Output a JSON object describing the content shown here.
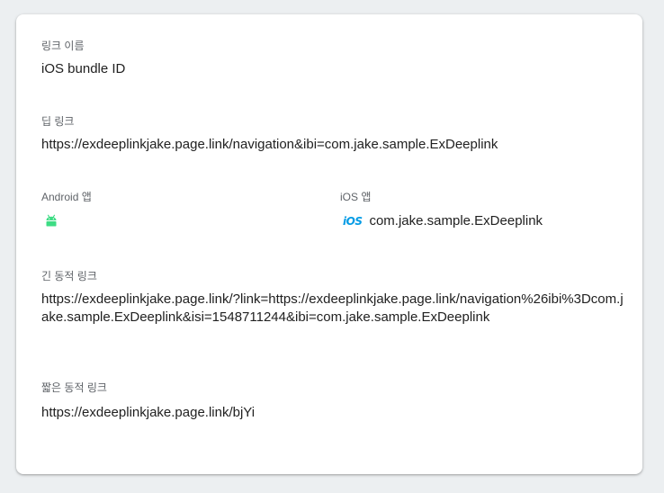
{
  "link_name": {
    "label": "링크 이름",
    "value": "iOS bundle ID"
  },
  "deep_link": {
    "label": "딥 링크",
    "value": "https://exdeeplinkjake.page.link/navigation&ibi=com.jake.sample.ExDeeplink"
  },
  "android_app": {
    "label": "Android 앱",
    "icon": "android-icon",
    "icon_color": "#3ddc84",
    "value": ""
  },
  "ios_app": {
    "label": "iOS 앱",
    "icon": "ios-icon",
    "icon_text": "iOS",
    "icon_color": "#039be5",
    "value": "com.jake.sample.ExDeeplink"
  },
  "long_dynamic_link": {
    "label": "긴 동적 링크",
    "value": "https://exdeeplinkjake.page.link/?link=https://exdeeplinkjake.page.link/navigation%26ibi%3Dcom.jake.sample.ExDeeplink&isi=1548711244&ibi=com.jake.sample.ExDeeplink"
  },
  "short_dynamic_link": {
    "label": "짧은 동적 링크",
    "value": "https://exdeeplinkjake.page.link/bjYi"
  }
}
